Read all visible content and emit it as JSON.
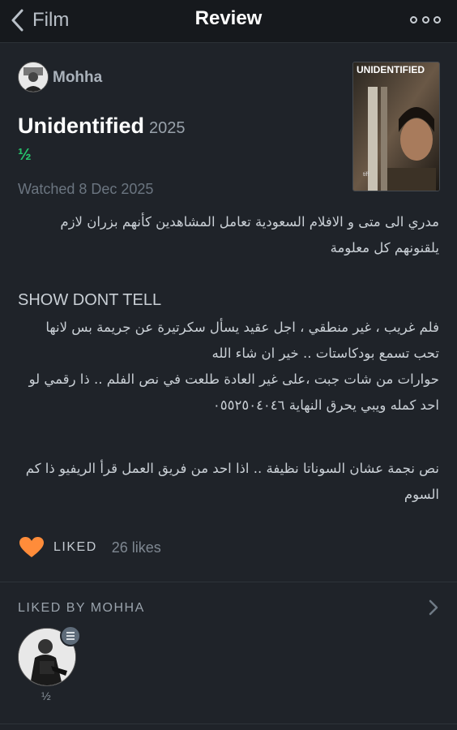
{
  "header": {
    "back_label": "Film",
    "title": "Review",
    "back_icon": "chevron-left-icon",
    "more_icon": "more-icon"
  },
  "review": {
    "username": "Mohha",
    "film_title": "Unidentified",
    "film_year": "2025",
    "rating": "½",
    "watched": "Watched 8 Dec 2025",
    "poster_title": "UNIDENTIFIED",
    "paragraphs": {
      "p1": "مدري الى متى و الافلام السعودية تعامل المشاهدين كأنهم بزران لازم يلقنونهم كل معلومة",
      "p2": "SHOW DONT TELL",
      "p3a": "فلم غريب ، غير منطقي ، اجل عقيد يسأل سكرتيرة عن جريمة بس لانها تحب تسمع بودكاستات .. خير ان شاء الله",
      "p3b": "حوارات من شات جبت ،على غير العادة طلعت في نص الفلم .. ذا رقمي لو احد كمله ويبي يحرق النهاية ٠٥٥٢٥٠٤٠٤٦",
      "p4": "نص نجمة عشان السوناتا نظيفة .. اذا احد من فريق العمل قرأ الريفيو ذا كم السوم"
    }
  },
  "likes": {
    "liked_label": "LIKED",
    "count_text": "26 likes",
    "heart_color": "#ff8c3a"
  },
  "liked_by": {
    "label": "LIKED BY MOHHA",
    "user_rating": "½"
  },
  "colors": {
    "background": "#1f2329",
    "header": "#16191d",
    "rating_green": "#26c26b"
  }
}
